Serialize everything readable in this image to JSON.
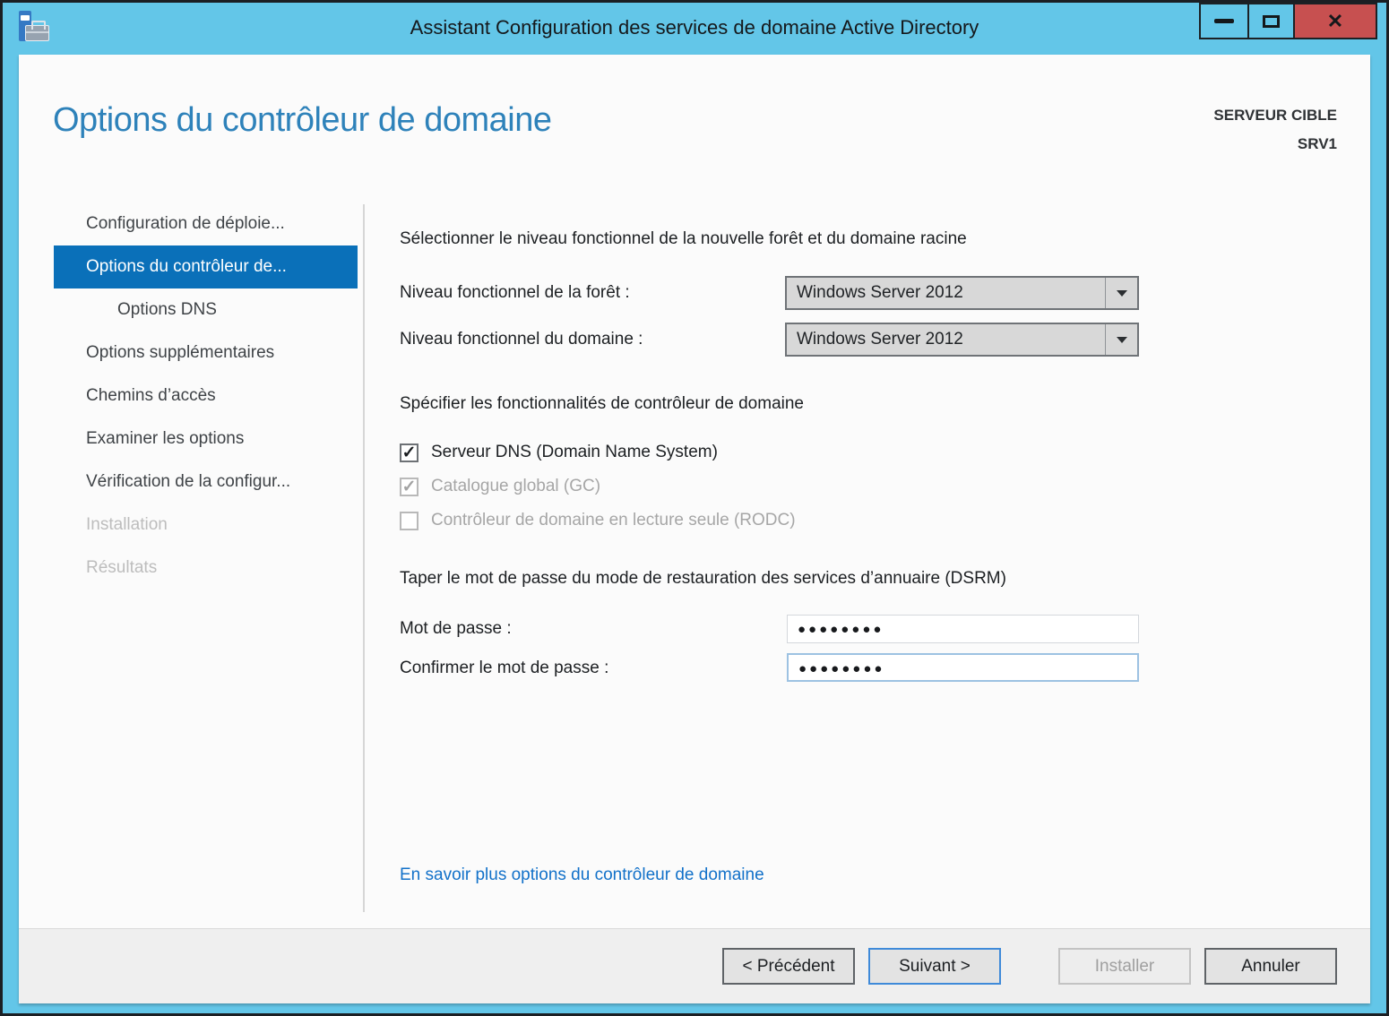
{
  "window": {
    "title": "Assistant Configuration des services de domaine Active Directory"
  },
  "icons": {
    "close": "✕",
    "check": "✓",
    "dropdown_arrow": "▼"
  },
  "header": {
    "title": "Options du contrôleur de domaine",
    "target_label": "SERVEUR CIBLE",
    "target_server": "SRV1"
  },
  "sidebar": {
    "items": [
      {
        "label": "Configuration de déploie...",
        "state": "normal"
      },
      {
        "label": "Options du contrôleur de...",
        "state": "selected"
      },
      {
        "label": "Options DNS",
        "state": "indent"
      },
      {
        "label": "Options supplémentaires",
        "state": "normal"
      },
      {
        "label": "Chemins d’accès",
        "state": "normal"
      },
      {
        "label": "Examiner les options",
        "state": "normal"
      },
      {
        "label": "Vérification de la configur...",
        "state": "normal"
      },
      {
        "label": "Installation",
        "state": "disabled"
      },
      {
        "label": "Résultats",
        "state": "disabled"
      }
    ]
  },
  "main": {
    "functional_section_title": "Sélectionner le niveau fonctionnel de la nouvelle forêt et du domaine racine",
    "forest_level": {
      "label": "Niveau fonctionnel de la forêt :",
      "value": "Windows Server 2012"
    },
    "domain_level": {
      "label": "Niveau fonctionnel du domaine :",
      "value": "Windows Server 2012"
    },
    "capabilities_section_title": "Spécifier les fonctionnalités de contrôleur de domaine",
    "checkboxes": [
      {
        "label": "Serveur DNS (Domain Name System)",
        "checked": true,
        "enabled": true
      },
      {
        "label": "Catalogue global (GC)",
        "checked": true,
        "enabled": false
      },
      {
        "label": "Contrôleur de domaine en lecture seule (RODC)",
        "checked": false,
        "enabled": false
      }
    ],
    "dsrm_section_title": "Taper le mot de passe du mode de restauration des services d’annuaire (DSRM)",
    "password": {
      "label": "Mot de passe :",
      "value": "●●●●●●●●"
    },
    "confirm_password": {
      "label": "Confirmer le mot de passe :",
      "value": "●●●●●●●●"
    },
    "learn_more_link": "En savoir plus options du contrôleur de domaine"
  },
  "footer": {
    "buttons": [
      {
        "label": "< Précédent"
      },
      {
        "label": "Suivant >"
      },
      {
        "label": "Installer"
      },
      {
        "label": "Annuler"
      }
    ]
  },
  "colors": {
    "frame_blue": "#63c6e8",
    "selected_blue": "#0a70b9",
    "heading_blue": "#2e82ba",
    "link_blue": "#1271c9",
    "close_red": "#c75050"
  }
}
